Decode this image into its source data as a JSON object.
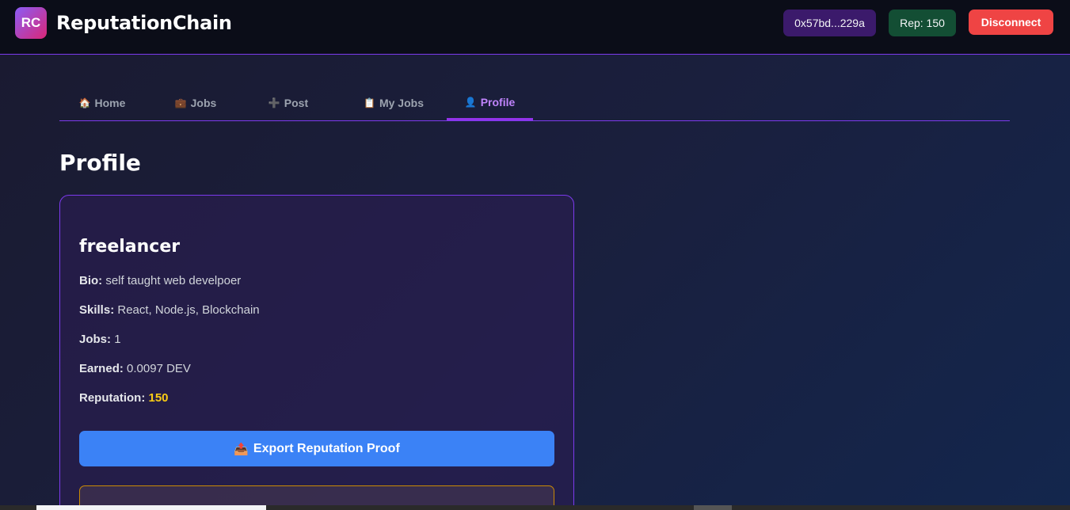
{
  "header": {
    "logo_text": "RC",
    "brand": "ReputationChain",
    "address": "0x57bd...229a",
    "reputation": "Rep: 150",
    "disconnect": "Disconnect"
  },
  "tabs": [
    {
      "icon": "house-icon",
      "glyph": "🏠",
      "label": "Home"
    },
    {
      "icon": "briefcase-icon",
      "glyph": "💼",
      "label": "Jobs"
    },
    {
      "icon": "plus-icon",
      "glyph": "➕",
      "label": "Post"
    },
    {
      "icon": "clipboard-icon",
      "glyph": "📋",
      "label": "My Jobs"
    },
    {
      "icon": "user-icon",
      "glyph": "👤",
      "label": "Profile"
    }
  ],
  "active_tab": "Profile",
  "page_title": "Profile",
  "profile": {
    "username": "freelancer",
    "bio_label": "Bio:",
    "bio": "self taught web develpoer",
    "skills_label": "Skills:",
    "skills": "React, Node.js, Blockchain",
    "jobs_label": "Jobs:",
    "jobs": "1",
    "earned_label": "Earned:",
    "earned": "0.0097 DEV",
    "reputation_label": "Reputation:",
    "reputation": "150",
    "export_glyph": "📤",
    "export_label": "Export Reputation Proof"
  },
  "colors": {
    "accent": "#7c3aed",
    "active_tab": "#c084fc",
    "reputation_value": "#facc15",
    "export_button": "#3b82f6",
    "disconnect_button": "#ef4444"
  }
}
